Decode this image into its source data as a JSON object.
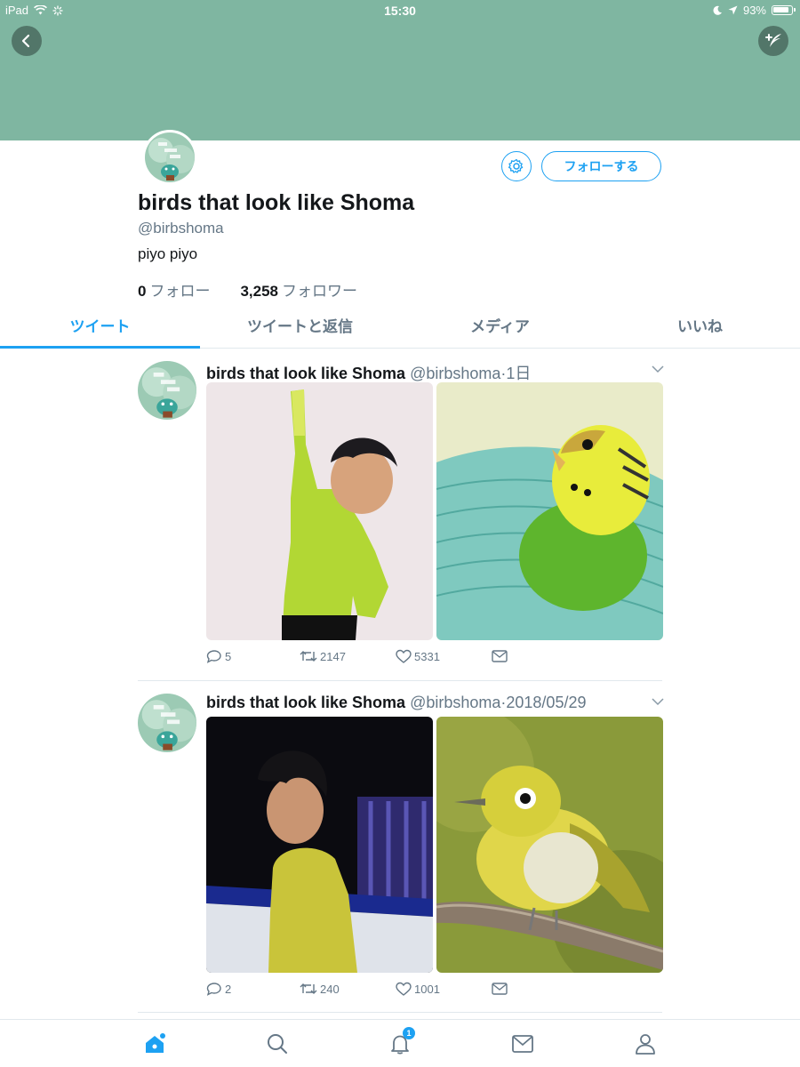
{
  "status_bar": {
    "device": "iPad",
    "time": "15:30",
    "battery": "93%"
  },
  "colors": {
    "banner": "#7fb6a1",
    "accent": "#1da1f2",
    "secondary_text": "#657786"
  },
  "profile": {
    "name": "birds that look like Shoma",
    "handle": "@birbshoma",
    "bio": "piyo piyo",
    "follow_button": "フォローする",
    "following_count": "0",
    "following_label": "フォロー",
    "followers_count": "3,258",
    "followers_label": "フォロワー"
  },
  "tabs": [
    {
      "label": "ツイート",
      "active": true
    },
    {
      "label": "ツイートと返信",
      "active": false
    },
    {
      "label": "メディア",
      "active": false
    },
    {
      "label": "いいね",
      "active": false
    }
  ],
  "tweets": [
    {
      "name": "birds that look like Shoma",
      "handle": "@birbshoma",
      "time": "1日",
      "replies": "5",
      "retweets": "2147",
      "likes": "5331",
      "images": [
        "skater-green-costume",
        "green-budgerigar"
      ]
    },
    {
      "name": "birds that look like Shoma",
      "handle": "@birbshoma",
      "time": "2018/05/29",
      "replies": "2",
      "retweets": "240",
      "likes": "1001",
      "images": [
        "skater-yellow-costume",
        "japanese-white-eye"
      ]
    }
  ],
  "bottom_nav": {
    "items": [
      "home-icon",
      "search-icon",
      "bell-icon",
      "mail-icon",
      "person-icon"
    ],
    "notifications_badge": "1"
  }
}
